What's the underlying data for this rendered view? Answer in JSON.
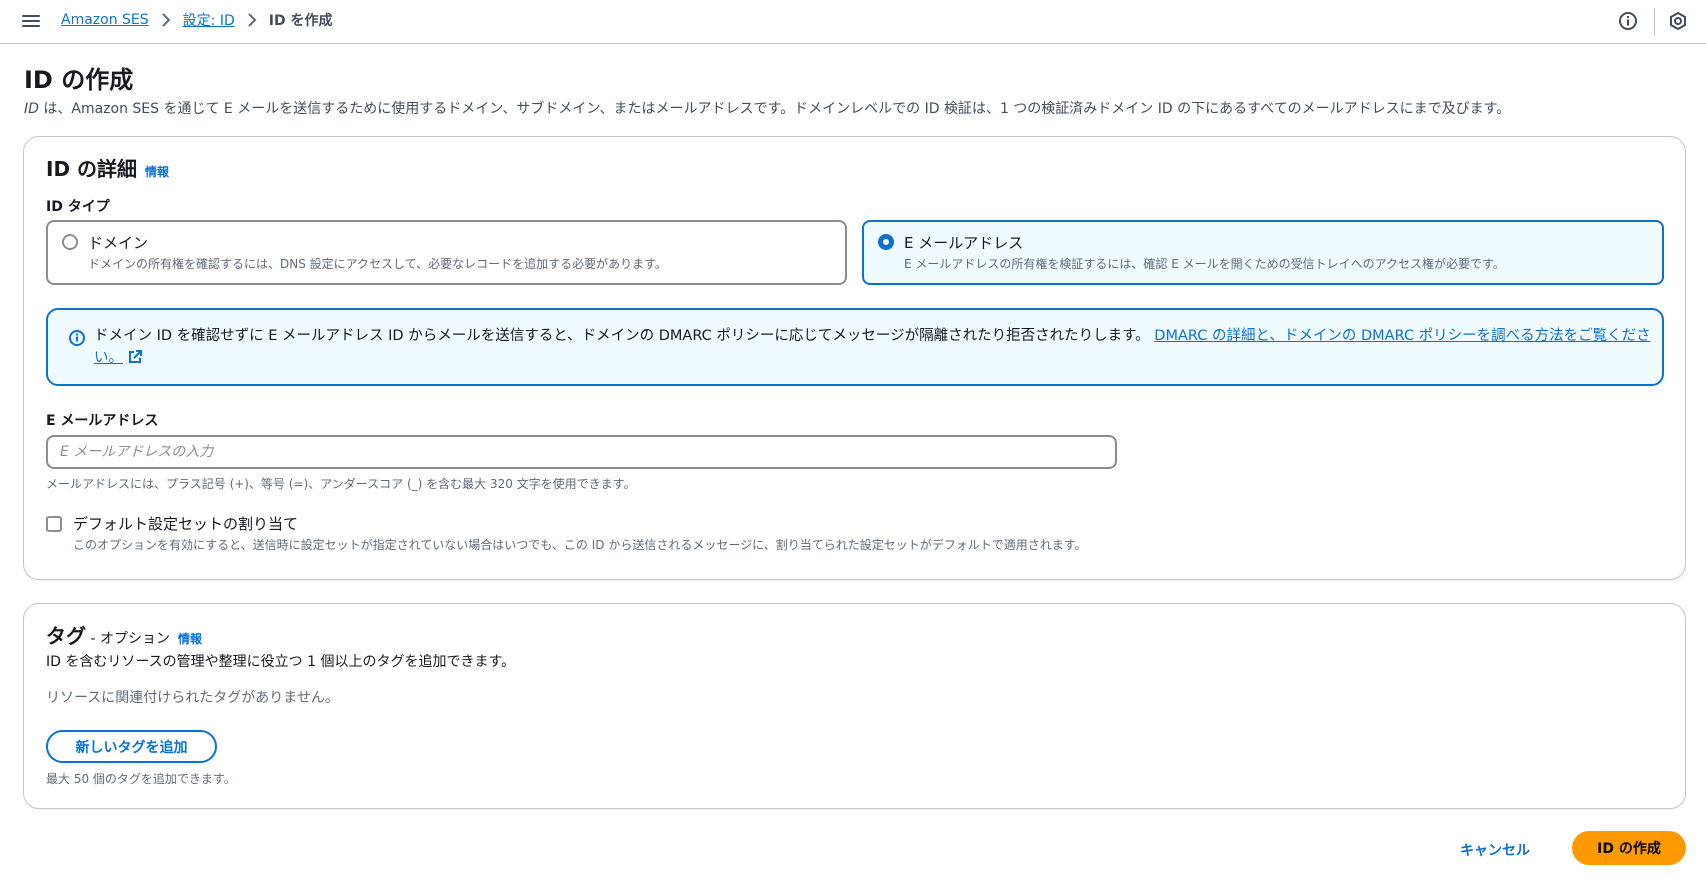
{
  "breadcrumb": {
    "items": [
      "Amazon SES",
      "設定: ID"
    ],
    "current": "ID を作成"
  },
  "page": {
    "title": "ID の作成",
    "desc_italic": "ID",
    "desc_rest": " は、Amazon SES を通じて E メールを送信するために使用するドメイン、サブドメイン、またはメールアドレスです。ドメインレベルでの ID 検証は、1 つの検証済みドメイン ID の下にあるすべてのメールアドレスにまで及びます。"
  },
  "details": {
    "title": "ID の詳細",
    "info": "情報",
    "type_label": "ID タイプ",
    "options": [
      {
        "label": "ドメイン",
        "desc": "ドメインの所有権を確認するには、DNS 設定にアクセスして、必要なレコードを追加する必要があります。",
        "selected": false
      },
      {
        "label": "E メールアドレス",
        "desc": "E メールアドレスの所有権を検証するには、確認 E メールを開くための受信トレイへのアクセス権が必要です。",
        "selected": true
      }
    ],
    "alert_text": "ドメイン ID を確認せずに E メールアドレス ID からメールを送信すると、ドメインの DMARC ポリシーに応じてメッセージが隔離されたり拒否されたりします。",
    "alert_link": "DMARC の詳細と、ドメインの DMARC ポリシーを調べる方法をご覧ください。",
    "email_label": "E メールアドレス",
    "email_placeholder": "E メールアドレスの入力",
    "email_value": "",
    "email_hint": "メールアドレスには、プラス記号 (+)、等号 (=)、アンダースコア (_) を含む最大 320 文字を使用できます。",
    "checkbox_label": "デフォルト設定セットの割り当て",
    "checkbox_desc": "このオプションを有効にすると、送信時に設定セットが指定されていない場合はいつでも、この ID から送信されるメッセージに、割り当てられた設定セットがデフォルトで適用されます。",
    "checkbox_checked": false
  },
  "tags": {
    "title": "タグ",
    "optional": " - オプション",
    "info": "情報",
    "desc": "ID を含むリソースの管理や整理に役立つ 1 個以上のタグを追加できます。",
    "empty": "リソースに関連付けられたタグがありません。",
    "add_button": "新しいタグを追加",
    "limit": "最大 50 個のタグを追加できます。"
  },
  "footer": {
    "cancel": "キャンセル",
    "submit": "ID の作成"
  },
  "colors": {
    "link": "#0972d3",
    "primary_button": "#ff9900",
    "alert_bg": "#f0fbff"
  },
  "icons": [
    "menu-icon",
    "chevron-right-icon",
    "info-circle-icon",
    "settings-hexagon-icon",
    "external-link-icon"
  ]
}
